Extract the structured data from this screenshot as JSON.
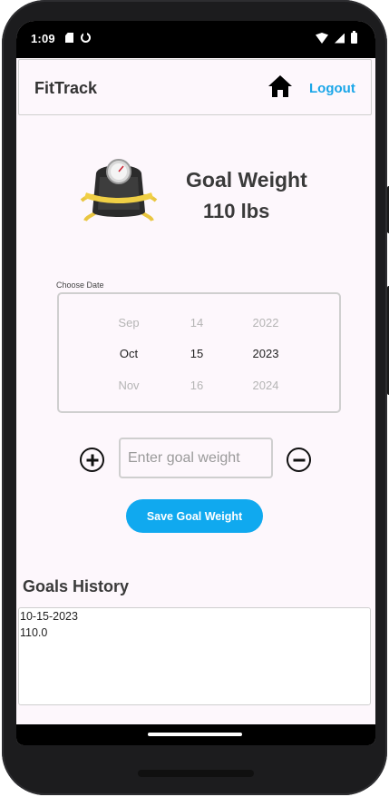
{
  "statusbar": {
    "time": "1:09",
    "icons": [
      "sd-card-icon",
      "sync-icon",
      "wifi-icon",
      "signal-icon",
      "battery-icon"
    ]
  },
  "header": {
    "title": "FitTrack",
    "home_icon": "home-icon",
    "logout_label": "Logout"
  },
  "goal": {
    "icon": "scale-icon",
    "label": "Goal Weight",
    "value": "110 lbs"
  },
  "date_picker": {
    "caption": "Choose Date",
    "months": [
      "Sep",
      "Oct",
      "Nov"
    ],
    "days": [
      "14",
      "15",
      "16"
    ],
    "years": [
      "2022",
      "2023",
      "2024"
    ],
    "selected": {
      "month": "Oct",
      "day": "15",
      "year": "2023"
    }
  },
  "stepper": {
    "increment_icon": "plus-circle-icon",
    "decrement_icon": "minus-circle-icon",
    "input_value": "",
    "input_placeholder": "Enter goal weight"
  },
  "save_button_label": "Save Goal Weight",
  "history": {
    "title": "Goals History",
    "entries": [
      {
        "date": "10-15-2023",
        "weight": "110.0"
      }
    ]
  },
  "colors": {
    "accent": "#10a9ef",
    "link": "#1aa6e8",
    "background": "#fdf7fc"
  }
}
